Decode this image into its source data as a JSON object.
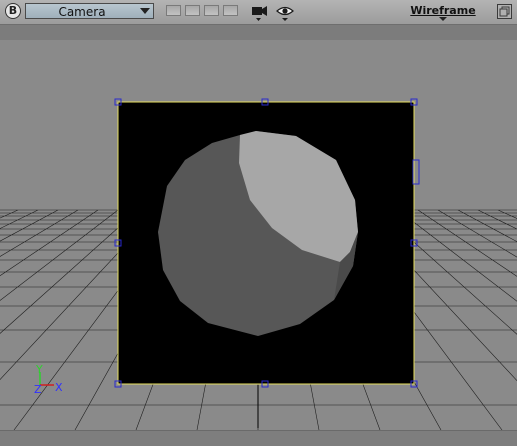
{
  "toolbar": {
    "badge_letter": "B",
    "view_name": "Camera",
    "shading_mode": "Wireframe"
  },
  "icons": {
    "camera": "camera-icon",
    "eye": "eye-icon",
    "maximize": "maximize-icon"
  },
  "axes": {
    "y": "Y",
    "z": "Z",
    "x": "X"
  },
  "colors": {
    "frame_border": "#e8e060",
    "handle": "#2a2acc",
    "render_background": "#000000",
    "axis_y": "#2fd02f",
    "axis_x": "#3030ff",
    "axis_z": "#3030ff"
  }
}
